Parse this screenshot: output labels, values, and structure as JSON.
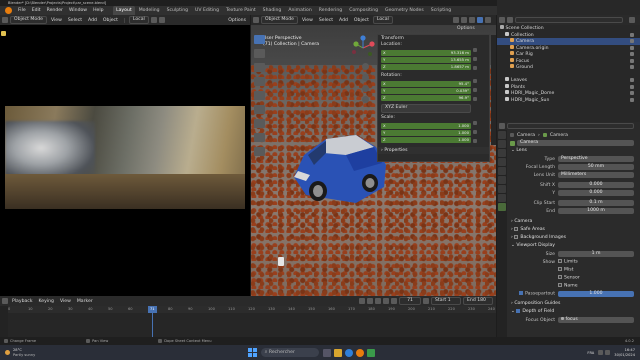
{
  "window": {
    "title": "Blender* [D:\\Blender\\Projects\\Project\\car_scene.blend]"
  },
  "menu": {
    "items": [
      "File",
      "Edit",
      "Render",
      "Window",
      "Help"
    ],
    "workspaces": [
      "Layout",
      "Modeling",
      "Sculpting",
      "UV Editing",
      "Texture Paint",
      "Shading",
      "Animation",
      "Rendering",
      "Compositing",
      "Geometry Nodes",
      "Scripting"
    ],
    "active_workspace": "Layout",
    "scene": "Scene",
    "view_layer": "ViewLayer"
  },
  "left_editor": {
    "mode": "Object Mode",
    "menu": [
      "View",
      "Select",
      "Add",
      "Object"
    ],
    "orientation": "Local",
    "options": "Options"
  },
  "viewport": {
    "mode": "Object Mode",
    "menu": [
      "View",
      "Select",
      "Add",
      "Object"
    ],
    "orientation": "Local",
    "options": "Options",
    "view_name": "User Perspective",
    "collection_info": "(71) Collection | Camera"
  },
  "transform_panel": {
    "title": "Transform",
    "location_label": "Location:",
    "location": [
      {
        "axis": "X",
        "value": "93.316 m"
      },
      {
        "axis": "Y",
        "value": "13.655 m"
      },
      {
        "axis": "Z",
        "value": "1.8657 m"
      }
    ],
    "rotation_label": "Rotation:",
    "rotation": [
      {
        "axis": "X",
        "value": "95.4°"
      },
      {
        "axis": "Y",
        "value": "0.039°"
      },
      {
        "axis": "Z",
        "value": "96.9°"
      }
    ],
    "rotation_mode": "XYZ Euler",
    "scale_label": "Scale:",
    "scale": [
      {
        "axis": "X",
        "value": "1.000"
      },
      {
        "axis": "Y",
        "value": "1.000"
      },
      {
        "axis": "Z",
        "value": "1.000"
      }
    ],
    "properties_label": "Properties"
  },
  "outliner": {
    "root": "Scene Collection",
    "rows": [
      {
        "label": "Collection",
        "indent": 1,
        "selected": false
      },
      {
        "label": "Camera",
        "indent": 2,
        "selected": true
      },
      {
        "label": "Camera.origin",
        "indent": 2,
        "selected": false
      },
      {
        "label": "Car Rig",
        "indent": 2,
        "selected": false
      },
      {
        "label": "Focus",
        "indent": 2,
        "selected": false
      },
      {
        "label": "Ground",
        "indent": 2,
        "selected": false
      },
      {
        "label": "",
        "indent": 0,
        "selected": false
      },
      {
        "label": "Leaves",
        "indent": 1,
        "selected": false
      },
      {
        "label": "Plants",
        "indent": 1,
        "selected": false
      },
      {
        "label": "HDRI_Magic_Dome",
        "indent": 1,
        "selected": false
      },
      {
        "label": "HDRI_Magic_Sun",
        "indent": 1,
        "selected": false
      }
    ]
  },
  "properties": {
    "breadcrumb": [
      "Camera",
      "Camera"
    ],
    "data_name": "Camera",
    "lens_section": "Lens",
    "type_label": "Type",
    "type_value": "Perspective",
    "focal_label": "Focal Length",
    "focal_value": "50 mm",
    "lens_unit_label": "Lens Unit",
    "lens_unit_value": "Millimeters",
    "shift_x_label": "Shift X",
    "shift_x_value": "0.000",
    "shift_y_label": "Y",
    "shift_y_value": "0.000",
    "clip_start_label": "Clip Start",
    "clip_start_value": "0.1 m",
    "clip_end_label": "End",
    "clip_end_value": "1000 m",
    "camera_section": "Camera",
    "safe_areas": "Safe Areas",
    "bg_images": "Background Images",
    "vp_display_section": "Viewport Display",
    "size_label": "Size",
    "size_value": "1 m",
    "show_label": "Show",
    "show_items": [
      "Limits",
      "Mist",
      "Sensor",
      "Name"
    ],
    "passepartout_label": "Passepartout",
    "passepartout_value": "1.000",
    "composition_guides": "Composition Guides",
    "dof_section": "Depth of Field",
    "focus_object_label": "Focus Object",
    "focus_object_value": "focus"
  },
  "timeline": {
    "menu": [
      "Playback",
      "Keying",
      "View",
      "Marker"
    ],
    "current_frame": "71",
    "start_label": "Start",
    "start_value": "1",
    "end_label": "End",
    "end_value": "180",
    "ticks": [
      "0",
      "10",
      "20",
      "30",
      "40",
      "50",
      "60",
      "71",
      "80",
      "90",
      "100",
      "110",
      "120",
      "130",
      "140",
      "150",
      "160",
      "170",
      "180",
      "190",
      "200",
      "210",
      "220",
      "230",
      "240"
    ]
  },
  "status": {
    "items": [
      "Change Frame",
      "Pan View",
      "Dope Sheet Context Menu"
    ],
    "version": "4.0.2"
  },
  "taskbar": {
    "weather_temp": "28°C",
    "weather_desc": "Partly sunny",
    "search_placeholder": "Rechercher",
    "lang": "FRA",
    "time": "16:47",
    "date": "30/01/2024"
  },
  "colors": {
    "accent": "#4772b3",
    "field_green": "#4b7a33",
    "blender_orange": "#e87d0d",
    "car_blue": "#2a52b5"
  }
}
